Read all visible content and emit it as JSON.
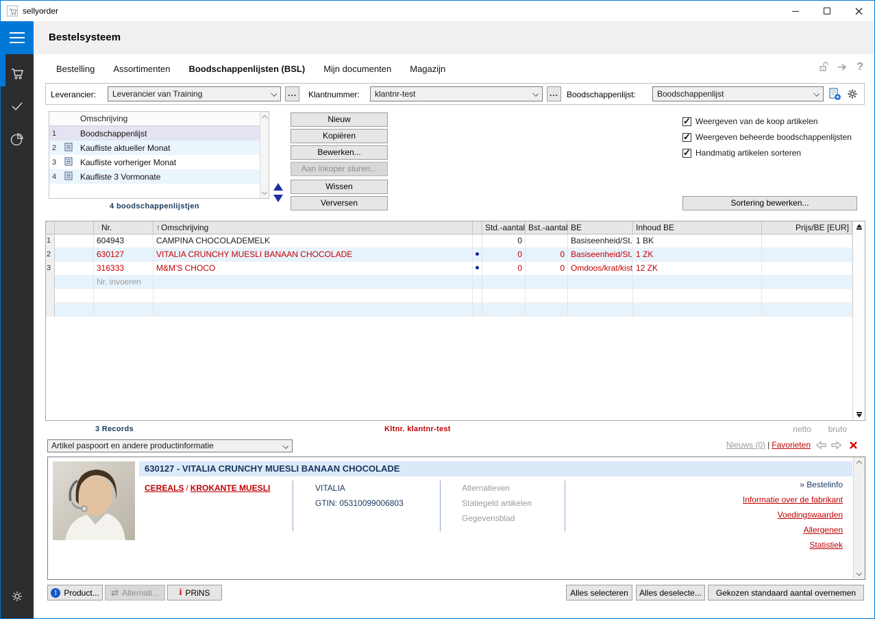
{
  "titlebar": {
    "title": "sellyorder"
  },
  "app": {
    "header": "Bestelsysteem"
  },
  "tabs": [
    {
      "label": "Bestelling",
      "active": false
    },
    {
      "label": "Assortimenten",
      "active": false
    },
    {
      "label": "Boodschappenlijsten (BSL)",
      "active": true
    },
    {
      "label": "Mijn documenten",
      "active": false
    },
    {
      "label": "Magazijn",
      "active": false
    }
  ],
  "filterbar": {
    "leverancier_label": "Leverancier:",
    "leverancier_value": "Leverancier van Training",
    "browse_label": "...",
    "klantnummer_label": "Klantnummer:",
    "klantnummer_value": "klantnr-test",
    "boodschappenlijst_label": "Boodschappenlijst:",
    "boodschappenlijst_value": "Boodschappenlijst"
  },
  "bsl": {
    "column_header": "Omschrijving",
    "rows": [
      {
        "num": "1",
        "label": "Boodschappenlijst",
        "selected": true
      },
      {
        "num": "2",
        "label": "Kaufliste aktueller Monat",
        "selected": false
      },
      {
        "num": "3",
        "label": "Kaufliste vorheriger Monat",
        "selected": false
      },
      {
        "num": "4",
        "label": "Kaufliste 3 Vormonate",
        "selected": false
      }
    ],
    "count_label": "4 boodschappenlijstjen",
    "buttons": {
      "nieuw": "Nieuw",
      "kopieren": "Kopiëren",
      "bewerken": "Bewerken...",
      "aan_inkoper": "Aan inkoper sturen...",
      "wissen": "Wissen",
      "verversen": "Verversen"
    },
    "checkboxes": [
      {
        "label": "Weergeven van de koop artikelen",
        "checked": true
      },
      {
        "label": "Weergeven beheerde boodschappenlijsten",
        "checked": true
      },
      {
        "label": "Handmatig artikelen sorteren",
        "checked": true
      }
    ],
    "sort_button": "Sortering bewerken..."
  },
  "articles": {
    "columns": {
      "nr": "Nr.",
      "omschrijving": "Omschrijving",
      "std": "Std.-aantal",
      "bst": "Bst.-aantal",
      "be": "BE",
      "inhoud": "Inhoud BE",
      "prijs": "Prijs/BE [EUR]"
    },
    "rows": [
      {
        "num": "1",
        "nr": "604943",
        "omschrijving": "CAMPINA CHOCOLADEMELK",
        "std": "0",
        "bst": "",
        "be": "Basiseenheid/St..",
        "inhoud": "1 BK",
        "prijs": ""
      },
      {
        "num": "2",
        "nr": "630127",
        "omschrijving": "VITALIA CRUNCHY MUESLI BANAAN CHOCOLADE",
        "std": "0",
        "bst": "0",
        "be": "Basiseenheid/St..",
        "inhoud": "1 ZK",
        "prijs": ""
      },
      {
        "num": "3",
        "nr": "316333",
        "omschrijving": "M&M'S CHOCO",
        "std": "0",
        "bst": "0",
        "be": "Omdoos/krat/kist",
        "inhoud": "12 ZK",
        "prijs": ""
      }
    ],
    "entry_placeholder": "Nr. invoeren",
    "records_label": "3 Records",
    "kltnr_label": "Kltnr. klantnr-test",
    "netto_label": "netto",
    "bruto_label": "bruto"
  },
  "infobar": {
    "dropdown_value": "Artikel paspoort en andere productinformatie",
    "nieuws_label": "Nieuws (0)",
    "separator": "|",
    "favorieten_label": "Favorieten"
  },
  "detail": {
    "title": "630127 - VITALIA CRUNCHY MUESLI BANAAN CHOCOLADE",
    "category_link_1": "CEREALS",
    "category_sep": "/",
    "category_link_2": "KROKANTE MUESLI",
    "brand": "VITALIA",
    "gtin": "GTIN: 05310099006803",
    "muted_items": [
      {
        "label": "Alternatieven"
      },
      {
        "label": "Statiegeld artikelen"
      },
      {
        "label": "Gegevensblad"
      }
    ],
    "bestelinfo_label": "» Bestelinfo",
    "links": [
      {
        "label": "Informatie over de fabrikant"
      },
      {
        "label": "Voedingswaarden"
      },
      {
        "label": "Allergenen"
      },
      {
        "label": "Statistiek"
      }
    ]
  },
  "bottombar": {
    "product": "Product...",
    "alternatief": "Alternati...",
    "prins": "PRiNS",
    "alles_selecteren": "Alles selecteren",
    "alles_deselecteren": "Alles deselecte...",
    "gekozen": "Gekozen standaard aantal overnemen"
  },
  "colors": {
    "accent": "#0078d7",
    "red": "#c40000",
    "navy": "#17375d",
    "row_alt": "#e7f3fc"
  }
}
